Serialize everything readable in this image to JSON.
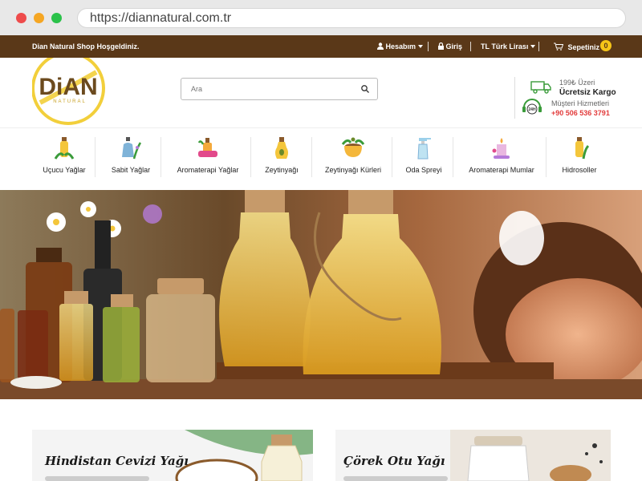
{
  "browser": {
    "url": "https://diannatural.com.tr"
  },
  "topbar": {
    "welcome": "Dian Natural Shop Hoşgeldiniz.",
    "account": "Hesabım",
    "login": "Giriş",
    "currency": "TL Türk Lirası",
    "cart": "Sepetiniz",
    "cart_count": "0"
  },
  "logo": {
    "text": "DiAN",
    "subtext": "NATURAL"
  },
  "search": {
    "placeholder": "Ara"
  },
  "shipping": {
    "line1": "199₺ Üzeri",
    "line2": "Ücretsiz Kargo"
  },
  "support": {
    "label": "Müşteri Hizmetleri",
    "phone": "+90 506 536 3791",
    "badge": "24H"
  },
  "categories": [
    {
      "label": "Uçucu Yağlar",
      "icon": "oil-bottle-icon"
    },
    {
      "label": "Sabit Yağlar",
      "icon": "herb-bottle-icon"
    },
    {
      "label": "Aromaterapi Yağlar",
      "icon": "aroma-set-icon"
    },
    {
      "label": "Zeytinyağı",
      "icon": "olive-oil-icon"
    },
    {
      "label": "Zeytinyağı Kürleri",
      "icon": "olive-bowl-icon"
    },
    {
      "label": "Oda Spreyi",
      "icon": "spray-icon"
    },
    {
      "label": "Aromaterapi Mumlar",
      "icon": "candle-icon"
    },
    {
      "label": "Hidrosoller",
      "icon": "hydrosol-bottle-icon"
    }
  ],
  "products": [
    {
      "title": "Hindistan Cevizi Yağı"
    },
    {
      "title": "Çörek Otu Yağı"
    }
  ],
  "colors": {
    "topbar": "#5a3818",
    "accent": "#f5c518",
    "phone": "#e23b3b"
  }
}
